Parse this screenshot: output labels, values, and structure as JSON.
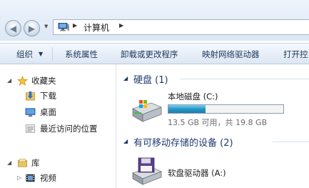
{
  "address_bar": {
    "location": "计算机"
  },
  "toolbar": {
    "items": [
      "组织",
      "系统属性",
      "卸载或更改程序",
      "映射网络驱动器",
      "打开控"
    ]
  },
  "nav": {
    "favorites": {
      "label": "收藏夹",
      "items": [
        "下载",
        "桌面",
        "最近访问的位置"
      ]
    },
    "libraries": {
      "label": "库",
      "items": [
        "视频"
      ]
    }
  },
  "content": {
    "hard_disks": {
      "title": "硬盘 (1)",
      "drive": {
        "name": "本地磁盘 (C:)",
        "info": "13.5 GB 可用，共 19.8 GB",
        "used_fraction": 0.32
      }
    },
    "removable": {
      "title": "有可移动存储的设备 (2)",
      "drive": {
        "name": "软盘驱动器 (A:)"
      }
    }
  },
  "colors": {
    "group_title": "#1e3c6e",
    "bar_fill": "#2596c3",
    "toolbar_text": "#1e395b"
  }
}
